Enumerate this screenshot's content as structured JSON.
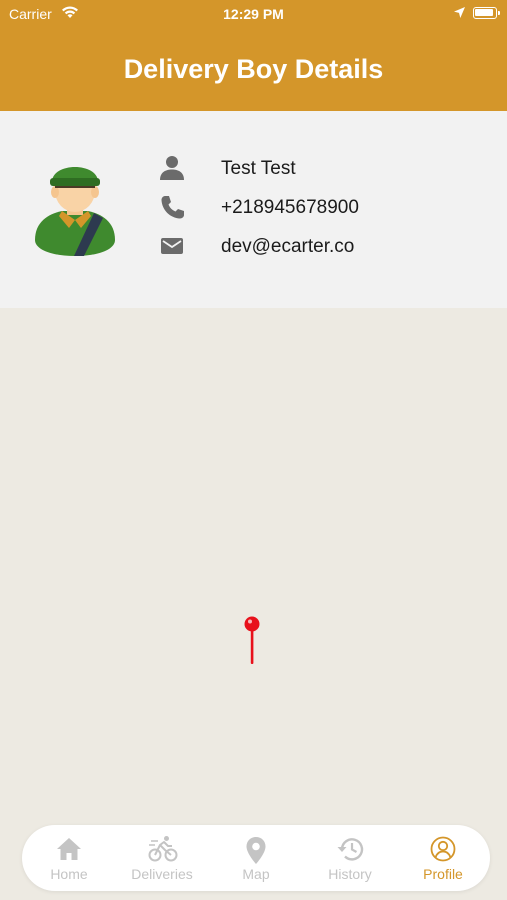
{
  "status_bar": {
    "carrier": "Carrier",
    "time": "12:29 PM"
  },
  "header": {
    "title": "Delivery Boy Details"
  },
  "profile": {
    "name": "Test Test",
    "phone": "+218945678900",
    "email": "dev@ecarter.co"
  },
  "tabs": [
    {
      "label": "Home",
      "icon": "home-icon",
      "active": false
    },
    {
      "label": "Deliveries",
      "icon": "bicycle-icon",
      "active": false
    },
    {
      "label": "Map",
      "icon": "map-pin-icon",
      "active": false
    },
    {
      "label": "History",
      "icon": "history-icon",
      "active": false
    },
    {
      "label": "Profile",
      "icon": "profile-icon",
      "active": true
    }
  ],
  "colors": {
    "accent": "#d4962a",
    "inactive_tab": "#c4c4c4",
    "map_background": "#edeae2",
    "pin": "#e8111b"
  }
}
